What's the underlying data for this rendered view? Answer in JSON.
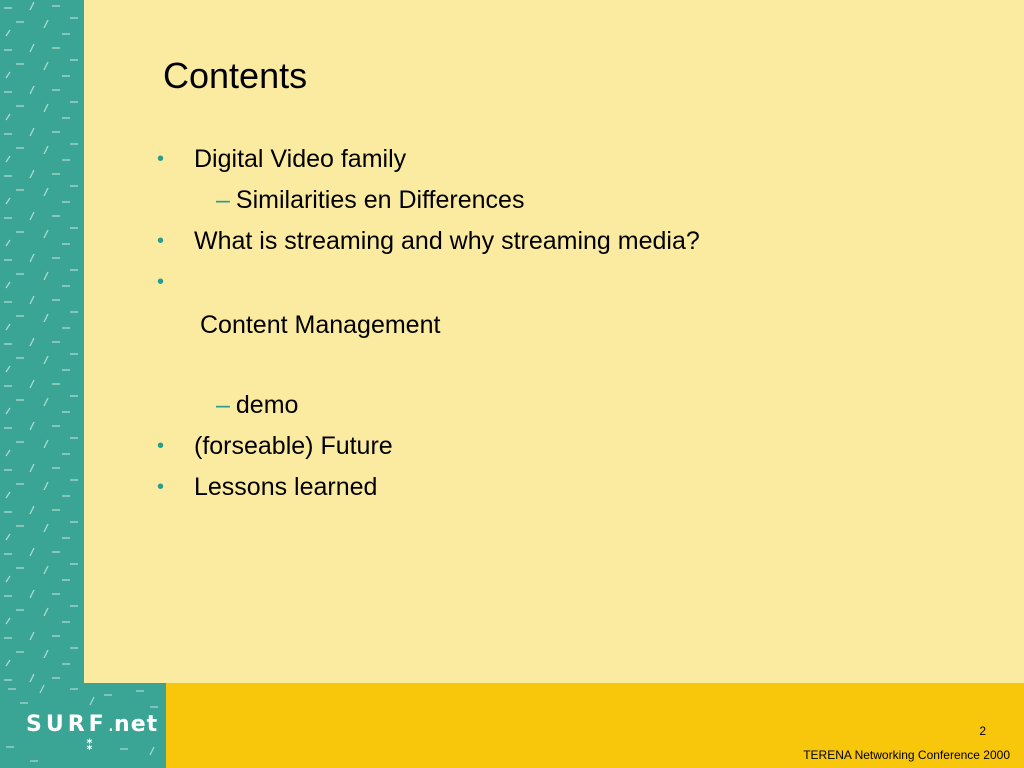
{
  "slide": {
    "title": "Contents",
    "bullet_symbol": "•",
    "dash_symbol": "–",
    "items": [
      {
        "level": 1,
        "text": "Digital Video family"
      },
      {
        "level": 2,
        "text": "Similarities en Differences"
      },
      {
        "level": 1,
        "text": "What is streaming and why streaming media?"
      },
      {
        "level": 1,
        "text": ""
      },
      {
        "level": 1,
        "text": "Content Management"
      },
      {
        "level": 2,
        "text": "demo"
      },
      {
        "level": 1,
        "text": "(forseable) Future"
      },
      {
        "level": 1,
        "text": "Lessons learned"
      }
    ]
  },
  "footer": {
    "page_number": "2",
    "conference": "TERENA Networking Conference 2000",
    "logo": "SURF",
    "logo_suffix": "net"
  },
  "colors": {
    "background": "#fbeba0",
    "side_band": "#3aa595",
    "bottom_band": "#f8c60b",
    "accent": "#2a9c8a"
  }
}
